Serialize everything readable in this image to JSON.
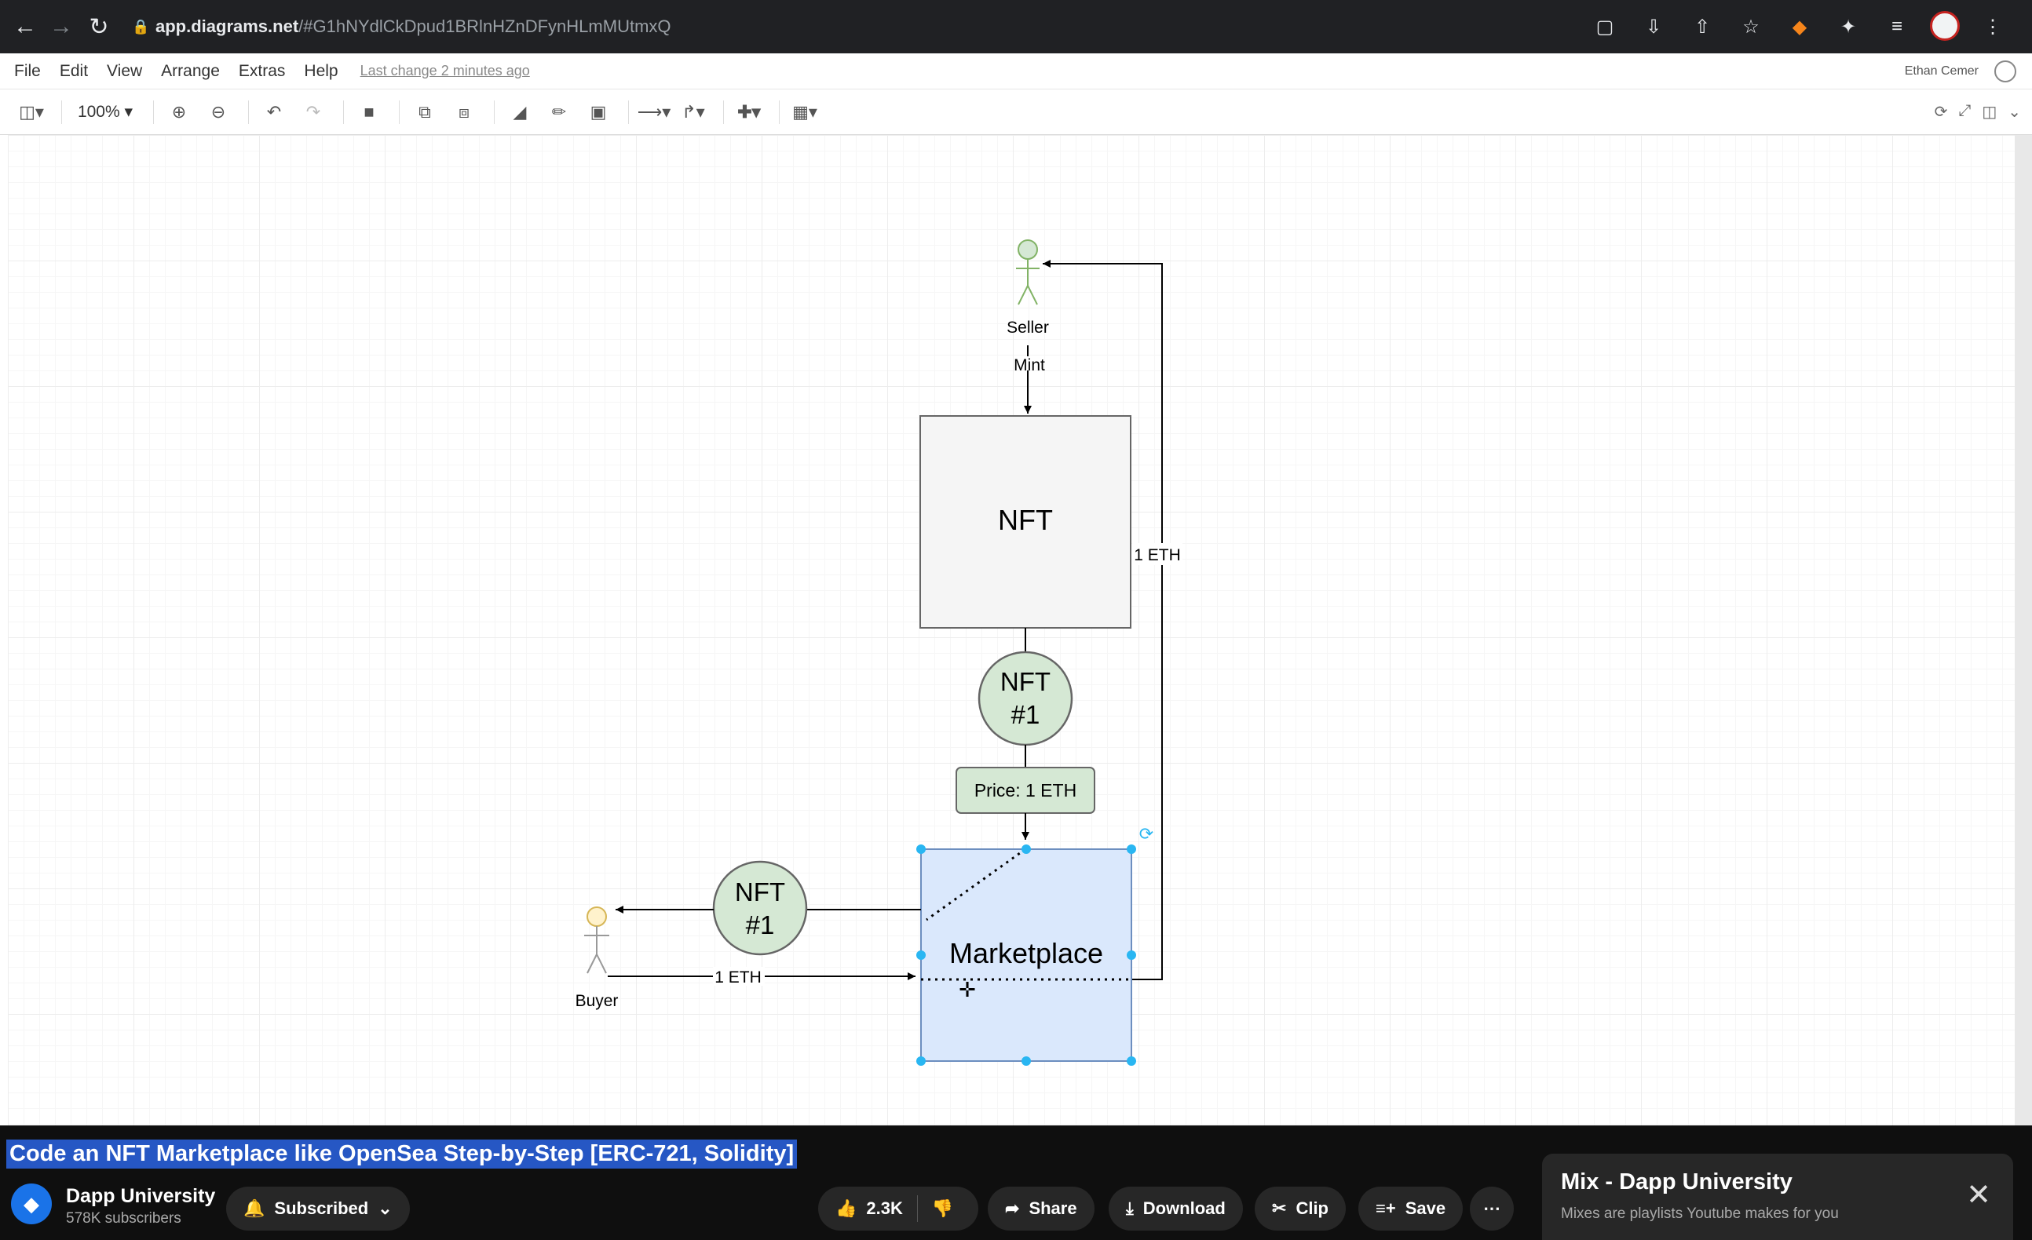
{
  "browser": {
    "url_host": "app.diagrams.net",
    "url_path": "/#G1hNYdlCkDpud1BRlnHZnDFynHLmMUtmxQ"
  },
  "menubar": {
    "items": [
      "File",
      "Edit",
      "View",
      "Arrange",
      "Extras",
      "Help"
    ],
    "last_change": "Last change 2 minutes ago",
    "user": "Ethan Cemer"
  },
  "toolbar": {
    "zoom": "100%"
  },
  "diagram": {
    "seller_label": "Seller",
    "mint_label": "Mint",
    "nft_box_label": "NFT",
    "eth_edge_label": "1 ETH",
    "nft_token_line1": "NFT",
    "nft_token_line2": "#1",
    "price_label": "Price: 1 ETH",
    "marketplace_label": "Marketplace",
    "buyer_token_line1": "NFT",
    "buyer_token_line2": "#1",
    "buyer_label": "Buyer",
    "buyer_eth_label": "1 ETH"
  },
  "youtube": {
    "video_title": "Code an NFT Marketplace like OpenSea Step-by-Step [ERC-721, Solidity]",
    "channel_name": "Dapp University",
    "channel_subs": "578K subscribers",
    "subscribed_label": "Subscribed",
    "likes": "2.3K",
    "share_label": "Share",
    "download_label": "Download",
    "clip_label": "Clip",
    "save_label": "Save",
    "mix_title": "Mix - Dapp University",
    "mix_subtitle": "Mixes are playlists Youtube makes for you"
  },
  "colors": {
    "marketplace_fill": "#dae8fc",
    "marketplace_stroke": "#6c8ebf",
    "token_fill": "#d5e8d4",
    "nft_box_fill": "#f5f5f5",
    "selection_handle": "#29b6f2",
    "title_highlight": "#2657c4"
  }
}
